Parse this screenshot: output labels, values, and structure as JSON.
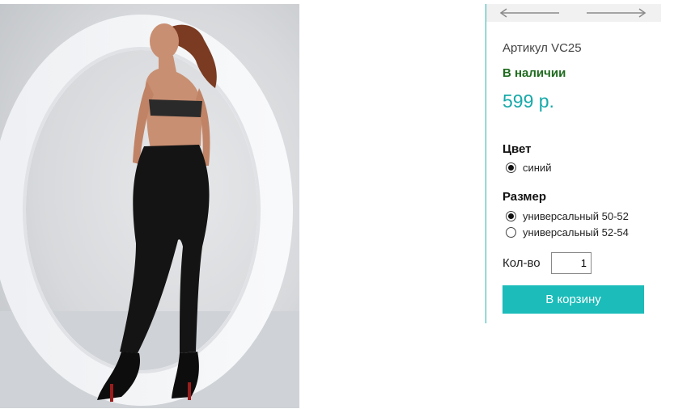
{
  "product": {
    "image_alt": "Model in black leggings, back view",
    "article": "Артикул VC25",
    "availability": "В наличии",
    "price": "599 р."
  },
  "nav": {
    "prev_icon": "arrow-left-icon",
    "next_icon": "arrow-right-icon"
  },
  "options": {
    "color_title": "Цвет",
    "colors": [
      {
        "label": "синий",
        "selected": true
      }
    ],
    "size_title": "Размер",
    "sizes": [
      {
        "label": "универсальный 50-52",
        "selected": true
      },
      {
        "label": "универсальный 52-54",
        "selected": false
      }
    ]
  },
  "quantity": {
    "label": "Кол-во",
    "value": "1"
  },
  "cart": {
    "button_label": "В корзину"
  },
  "colors": {
    "accent": "#1bbcb9",
    "price": "#17a9a9",
    "in_stock": "#1e6b1e",
    "divider": "#29b5b3"
  }
}
